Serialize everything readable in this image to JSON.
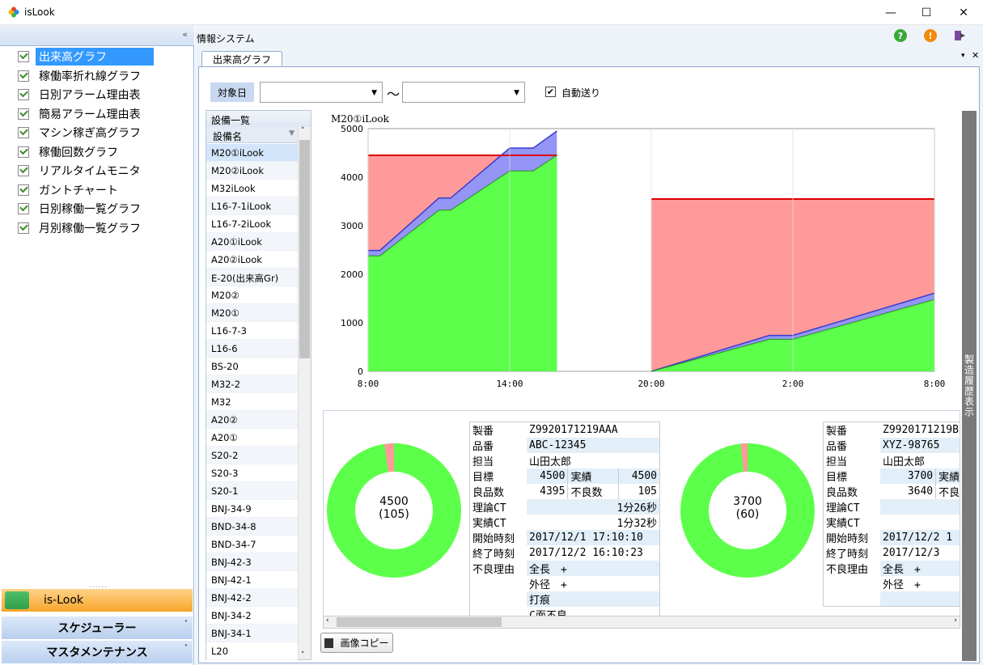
{
  "window": {
    "title": "isLook"
  },
  "sidebar": {
    "items": [
      {
        "label": "出来高グラフ"
      },
      {
        "label": "稼働率折れ線グラフ"
      },
      {
        "label": "日別アラーム理由表"
      },
      {
        "label": "簡易アラーム理由表"
      },
      {
        "label": "マシン稼ぎ高グラフ"
      },
      {
        "label": "稼働回数グラフ"
      },
      {
        "label": "リアルタイムモニタ"
      },
      {
        "label": "ガントチャート"
      },
      {
        "label": "日別稼働一覧グラフ"
      },
      {
        "label": "月別稼働一覧グラフ"
      }
    ],
    "grip": "......",
    "bottom_nav": [
      {
        "label": "is-Look"
      },
      {
        "label": "スケジューラー"
      },
      {
        "label": "マスタメンテナンス"
      }
    ]
  },
  "header": {
    "title": "情報システム"
  },
  "tab": {
    "label": "出来高グラフ"
  },
  "filter": {
    "date_label": "対象日",
    "tilde": "〜",
    "auto_label": "自動送り",
    "auto_checked": true
  },
  "equipment": {
    "panel_title": "設備一覧",
    "column": "設備名",
    "rows": [
      "M20①iLook",
      "M20②iLook",
      "M32iLook",
      "L16-7-1iLook",
      "L16-7-2iLook",
      "A20①iLook",
      "A20②iLook",
      "E-20(出来高Gr)",
      "M20②",
      "M20①",
      "L16-7-3",
      "L16-6",
      "BS-20",
      "M32-2",
      "M32",
      "A20②",
      "A20①",
      "S20-2",
      "S20-3",
      "S20-1",
      "BNJ-34-9",
      "BND-34-8",
      "BND-34-7",
      "BNJ-42-3",
      "BNJ-42-1",
      "BNJ-42-2",
      "BNJ-34-2",
      "BNJ-34-1",
      "L20"
    ]
  },
  "side_button": "製造履歴表示",
  "copy_button": "画像コピー",
  "chart_data": {
    "type": "area",
    "title": "M20①iLook",
    "y_ticks": [
      "0",
      "1000",
      "2000",
      "3000",
      "4000",
      "5000"
    ],
    "x_ticks": [
      "8:00",
      "14:00",
      "20:00",
      "2:00",
      "8:00"
    ],
    "ylim": [
      0,
      5000
    ],
    "xlim_hours": [
      0,
      24
    ],
    "colors": {
      "good": "#5cff4a",
      "defect": "#9595f5",
      "target_fill": "#ff9a9a",
      "target_line": "#dd0000"
    },
    "segments": [
      {
        "target": 4450,
        "target_x": [
          0,
          8
        ],
        "x": [
          0,
          0.5,
          3,
          3.5,
          6,
          7,
          8,
          8
        ],
        "good": [
          2380,
          2380,
          3320,
          3320,
          4130,
          4130,
          4450,
          4450
        ],
        "total": [
          2490,
          2490,
          3570,
          3570,
          4600,
          4600,
          4950,
          4950
        ]
      },
      {
        "target": 3550,
        "target_x": [
          12,
          24
        ],
        "x": [
          12,
          17,
          18,
          24
        ],
        "good": [
          0,
          660,
          660,
          1480
        ],
        "total": [
          0,
          740,
          740,
          1610
        ]
      }
    ]
  },
  "cards": [
    {
      "donut_main": "4500",
      "donut_sub": "(105)",
      "defect_fraction": 0.0233,
      "rows": [
        {
          "k": "製番",
          "v": "Z9920171219AAA"
        },
        {
          "k": "品番",
          "v": "ABC-12345"
        },
        {
          "k": "担当",
          "v": "山田太郎"
        },
        {
          "k": "目標",
          "v": "4500",
          "k2": "実績",
          "v2": "4500"
        },
        {
          "k": "良品数",
          "v": "4395",
          "k2": "不良数",
          "v2": "105"
        },
        {
          "k": "理論CT",
          "v": "1分26秒"
        },
        {
          "k": "実績CT",
          "v": "1分32秒"
        },
        {
          "k": "開始時刻",
          "v": "2017/12/1 17:10:10"
        },
        {
          "k": "終了時刻",
          "v": "2017/12/2 16:10:23"
        },
        {
          "k": "不良理由",
          "v": "全長　+"
        },
        {
          "k": "",
          "v": "外径　+"
        },
        {
          "k": "",
          "v": "打痕"
        },
        {
          "k": "",
          "v": "C面不良"
        }
      ]
    },
    {
      "donut_main": "3700",
      "donut_sub": "(60)",
      "defect_fraction": 0.0162,
      "rows": [
        {
          "k": "製番",
          "v": "Z9920171219B"
        },
        {
          "k": "品番",
          "v": "XYZ-98765"
        },
        {
          "k": "担当",
          "v": "山田太郎"
        },
        {
          "k": "目標",
          "v": "3700",
          "k2": "実績",
          "v2": ""
        },
        {
          "k": "良品数",
          "v": "3640",
          "k2": "不良数",
          "v2": ""
        },
        {
          "k": "理論CT",
          "v": ""
        },
        {
          "k": "実績CT",
          "v": ""
        },
        {
          "k": "開始時刻",
          "v": "2017/12/2 1"
        },
        {
          "k": "終了時刻",
          "v": "2017/12/3"
        },
        {
          "k": "不良理由",
          "v": "全長　+"
        },
        {
          "k": "",
          "v": "外径　+"
        },
        {
          "k": "",
          "v": ""
        }
      ]
    }
  ]
}
